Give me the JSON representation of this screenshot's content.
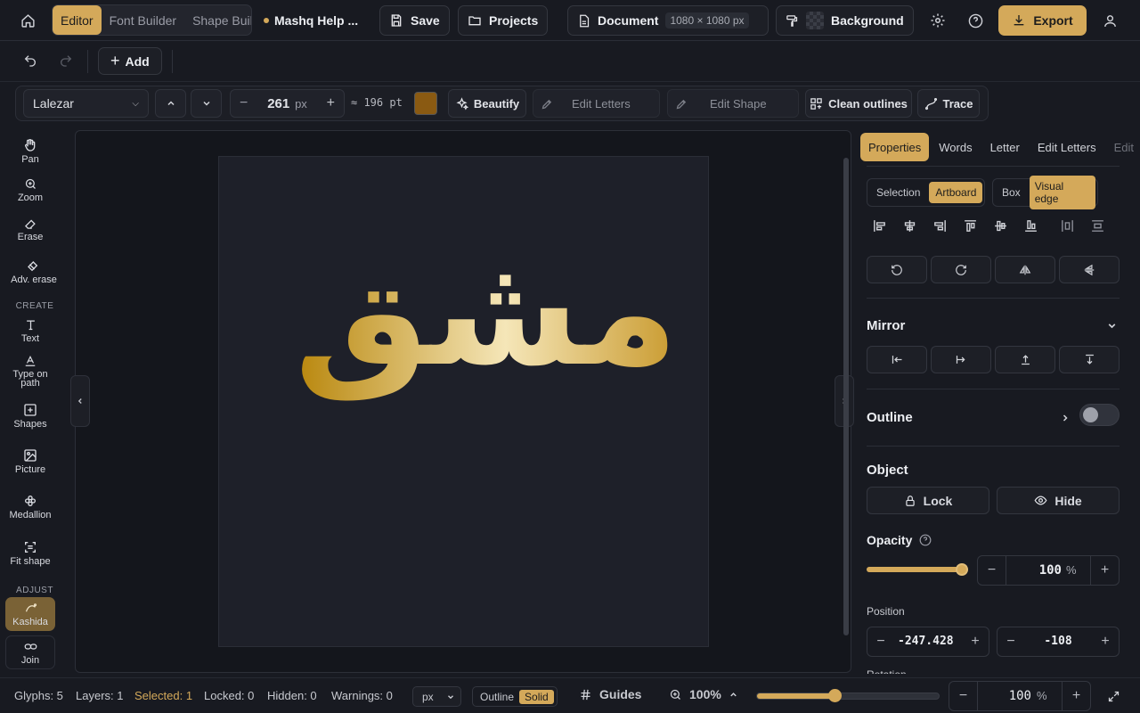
{
  "topbar": {
    "modes": [
      "Editor",
      "Font Builder",
      "Shape Builder"
    ],
    "help_label": "Mashq Help ...",
    "save_label": "Save",
    "projects_label": "Projects",
    "document_label": "Document",
    "document_size": "1080 × 1080 px",
    "background_label": "Background",
    "export_label": "Export"
  },
  "toolbar2": {
    "add_label": "Add"
  },
  "textbar": {
    "font": "Lalezar",
    "size": "261",
    "size_unit": "px",
    "pt_equiv": "≈ 196 pt",
    "color": "#8a5a12",
    "beautify": "Beautify",
    "edit_letters": "Edit Letters",
    "edit_shape": "Edit Shape",
    "clean_outlines": "Clean outlines",
    "trace": "Trace"
  },
  "tools": {
    "pan": "Pan",
    "zoom": "Zoom",
    "erase": "Erase",
    "adv_erase": "Adv. erase",
    "create_heading": "CREATE",
    "text": "Text",
    "type_on_path": "Type on path",
    "shapes": "Shapes",
    "picture": "Picture",
    "medallion": "Medallion",
    "fit_shape": "Fit shape",
    "adjust_heading": "ADJUST",
    "kashida": "Kashida",
    "join": "Join"
  },
  "canvas": {
    "word": "مشق",
    "gradient_colors": [
      "#b8860b",
      "#f5e6b8",
      "#c99a2e"
    ]
  },
  "panel": {
    "tabs": [
      "Properties",
      "Words",
      "Letter",
      "Edit Letters",
      "Edit"
    ],
    "align_to": [
      "Selection",
      "Artboard"
    ],
    "bounds": [
      "Box",
      "Visual edge"
    ],
    "mirror_title": "Mirror",
    "outline_title": "Outline",
    "object_title": "Object",
    "lock_label": "Lock",
    "hide_label": "Hide",
    "opacity_title": "Opacity",
    "opacity_value": "100",
    "opacity_unit": "%",
    "opacity_fraction": 1.0,
    "position_title": "Position",
    "position_x": "-247.428",
    "position_y": "-108",
    "rotation_title": "Rotation"
  },
  "status": {
    "glyphs": "Glyphs: 5",
    "layers": "Layers: 1",
    "selected": "Selected: 1",
    "locked": "Locked: 0",
    "hidden": "Hidden: 0",
    "warnings": "Warnings: 0",
    "unit": "px",
    "outline": "Outline",
    "solid": "Solid",
    "guides": "Guides",
    "zoom": "100%",
    "zoom_value": "100",
    "zoom_unit": "%",
    "zoom_fraction": 0.42
  },
  "colors": {
    "accent": "#d4a95a",
    "panel_bg": "#181a21",
    "canvas_bg": "#14161c"
  }
}
